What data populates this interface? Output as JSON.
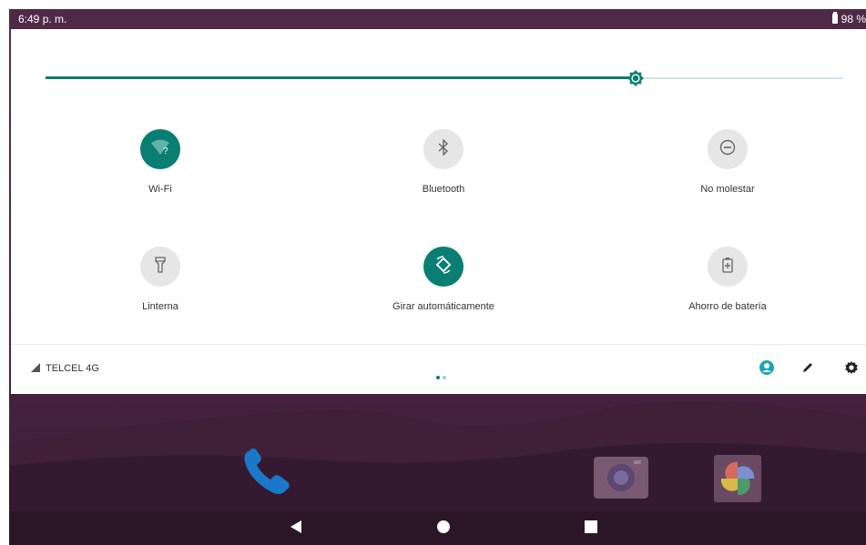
{
  "status_bar": {
    "time": "6:49 p. m.",
    "battery": "98 %"
  },
  "brightness": {
    "level": 0.74,
    "accent": "#0a7e72",
    "icon": "brightness-icon"
  },
  "tiles": [
    {
      "label": "Wi-Fi",
      "icon": "wifi-question-icon",
      "active": true
    },
    {
      "label": "Bluetooth",
      "icon": "bluetooth-icon",
      "active": false
    },
    {
      "label": "No molestar",
      "icon": "do-not-disturb-icon",
      "active": false
    },
    {
      "label": "Linterna",
      "icon": "flashlight-icon",
      "active": false
    },
    {
      "label": "Girar automáticamente",
      "icon": "auto-rotate-icon",
      "active": true
    },
    {
      "label": "Ahorro de batería",
      "icon": "battery-saver-icon",
      "active": false
    }
  ],
  "footer": {
    "carrier": "TELCEL 4G",
    "page_indicator": {
      "pages": 2,
      "current": 1
    },
    "buttons": [
      "user-icon",
      "edit-icon",
      "settings-icon"
    ]
  },
  "navigation": [
    "back-icon",
    "home-icon",
    "recents-icon"
  ],
  "colors": {
    "accent": "#0a7e72",
    "tile_inactive": "#e6e6e6",
    "wallpaper": "#4c2744"
  }
}
